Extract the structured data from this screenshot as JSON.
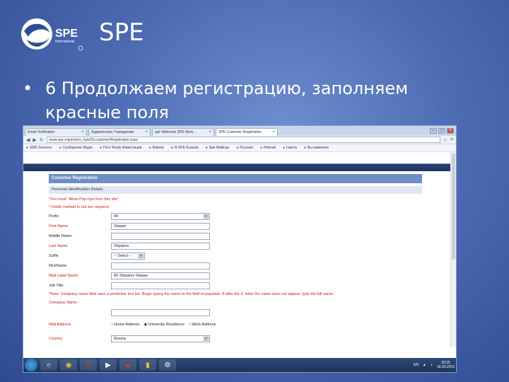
{
  "slide": {
    "title": "SPE",
    "bullet_marker": "•",
    "bullet_text": "6 Продолжаем регистрацию, заполняем красные поля",
    "logo_text": "SPE",
    "logo_sub": "International"
  },
  "browser": {
    "tabs": [
      {
        "label": "Email Verification",
        "active": false
      },
      {
        "label": "Aудиоинтерн Учреждение",
        "active": false
      },
      {
        "label": "spe Welcome SPE Mem...",
        "active": false
      },
      {
        "label": "SPE Customer Registration",
        "active": true
      }
    ],
    "url": "www.spe.org/ams/rs_/spe/SLcustomer/Registration.aspx",
    "bookmarks": [
      "SMS Services",
      "Сообщение Skype",
      "Пост Reply Инвестиции",
      "Rabota",
      "H-SPE-Eurasia",
      "Spe Mailings",
      "Русская",
      "Hotmail",
      "Газета",
      "Вы измените"
    ]
  },
  "form": {
    "section_title": "Customer Registration",
    "subsection_title": "Personal Identification Details",
    "note_popup": "*You must \"Allow Pop-Ups from this site\"",
    "note_required": "* Fields marked in red are required",
    "fields": {
      "prefix": {
        "label": "Prefix",
        "value": "Mr."
      },
      "first_name": {
        "label": "First Name",
        "value": "Stepan"
      },
      "middle_name": {
        "label": "Middle Name",
        "value": ""
      },
      "last_name": {
        "label": "Last Name",
        "value": "Shpakov"
      },
      "suffix": {
        "label": "Suffix",
        "value": "-- Select --"
      },
      "nickname": {
        "label": "NickName",
        "value": ""
      },
      "mail_label_name": {
        "label": "Mail Label Name",
        "value": "Mr Shpakov Stepan"
      },
      "job_title": {
        "label": "Job Title",
        "value": ""
      },
      "company_name": {
        "label": "Company Name",
        "value": ""
      },
      "mail_address": {
        "label": "Mail Address"
      },
      "country": {
        "label": "Country",
        "value": "Russia"
      }
    },
    "company_note": "*Note: Company name field uses a predictive text list. Begin typing the name to the field to populate. If after the 4. letter the name does not appear, type the full name.",
    "address_options": [
      {
        "label": "Home Address",
        "checked": false
      },
      {
        "label": "University Residence",
        "checked": true
      },
      {
        "label": "Work Address",
        "checked": false
      }
    ]
  },
  "taskbar": {
    "lang": "EN",
    "time": "20:25",
    "date": "16.03.2016"
  }
}
